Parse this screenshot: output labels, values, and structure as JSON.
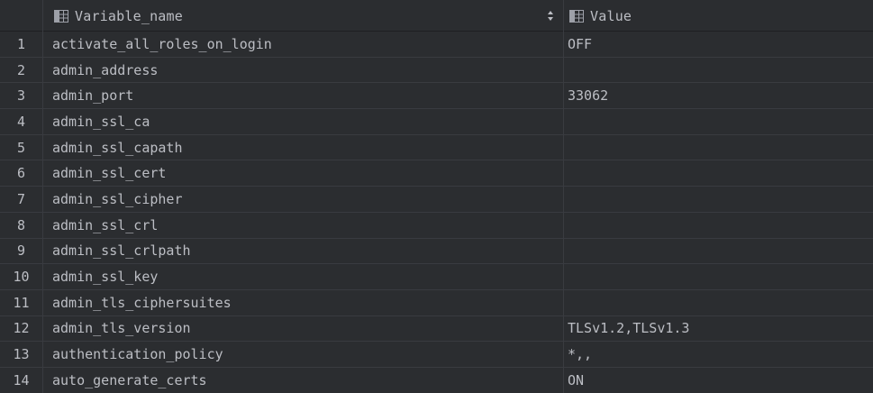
{
  "columns": {
    "name": {
      "label": "Variable_name",
      "icon": "table-column-icon"
    },
    "value": {
      "label": "Value",
      "icon": "table-column-icon"
    }
  },
  "rows": [
    {
      "n": "1",
      "name": "activate_all_roles_on_login",
      "value": "OFF"
    },
    {
      "n": "2",
      "name": "admin_address",
      "value": ""
    },
    {
      "n": "3",
      "name": "admin_port",
      "value": "33062"
    },
    {
      "n": "4",
      "name": "admin_ssl_ca",
      "value": ""
    },
    {
      "n": "5",
      "name": "admin_ssl_capath",
      "value": ""
    },
    {
      "n": "6",
      "name": "admin_ssl_cert",
      "value": ""
    },
    {
      "n": "7",
      "name": "admin_ssl_cipher",
      "value": ""
    },
    {
      "n": "8",
      "name": "admin_ssl_crl",
      "value": ""
    },
    {
      "n": "9",
      "name": "admin_ssl_crlpath",
      "value": ""
    },
    {
      "n": "10",
      "name": "admin_ssl_key",
      "value": ""
    },
    {
      "n": "11",
      "name": "admin_tls_ciphersuites",
      "value": ""
    },
    {
      "n": "12",
      "name": "admin_tls_version",
      "value": "TLSv1.2,TLSv1.3"
    },
    {
      "n": "13",
      "name": "authentication_policy",
      "value": "*,,"
    },
    {
      "n": "14",
      "name": "auto_generate_certs",
      "value": "ON"
    }
  ],
  "colors": {
    "background": "#2b2d30",
    "text": "#bcbec4",
    "gridline": "#393b40"
  }
}
